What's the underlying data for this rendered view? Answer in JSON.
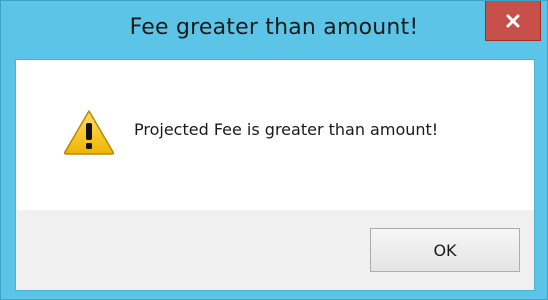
{
  "window": {
    "title": "Fee greater than amount!",
    "close_icon": "close-icon"
  },
  "dialog": {
    "icon": "warning-icon",
    "message": "Projected Fee is greater than amount!",
    "ok_label": "OK"
  },
  "colors": {
    "titlebar": "#5cc4e6",
    "close_button": "#c7504a",
    "warning_fill": "#f5c518",
    "footer": "#f0f0f0"
  }
}
